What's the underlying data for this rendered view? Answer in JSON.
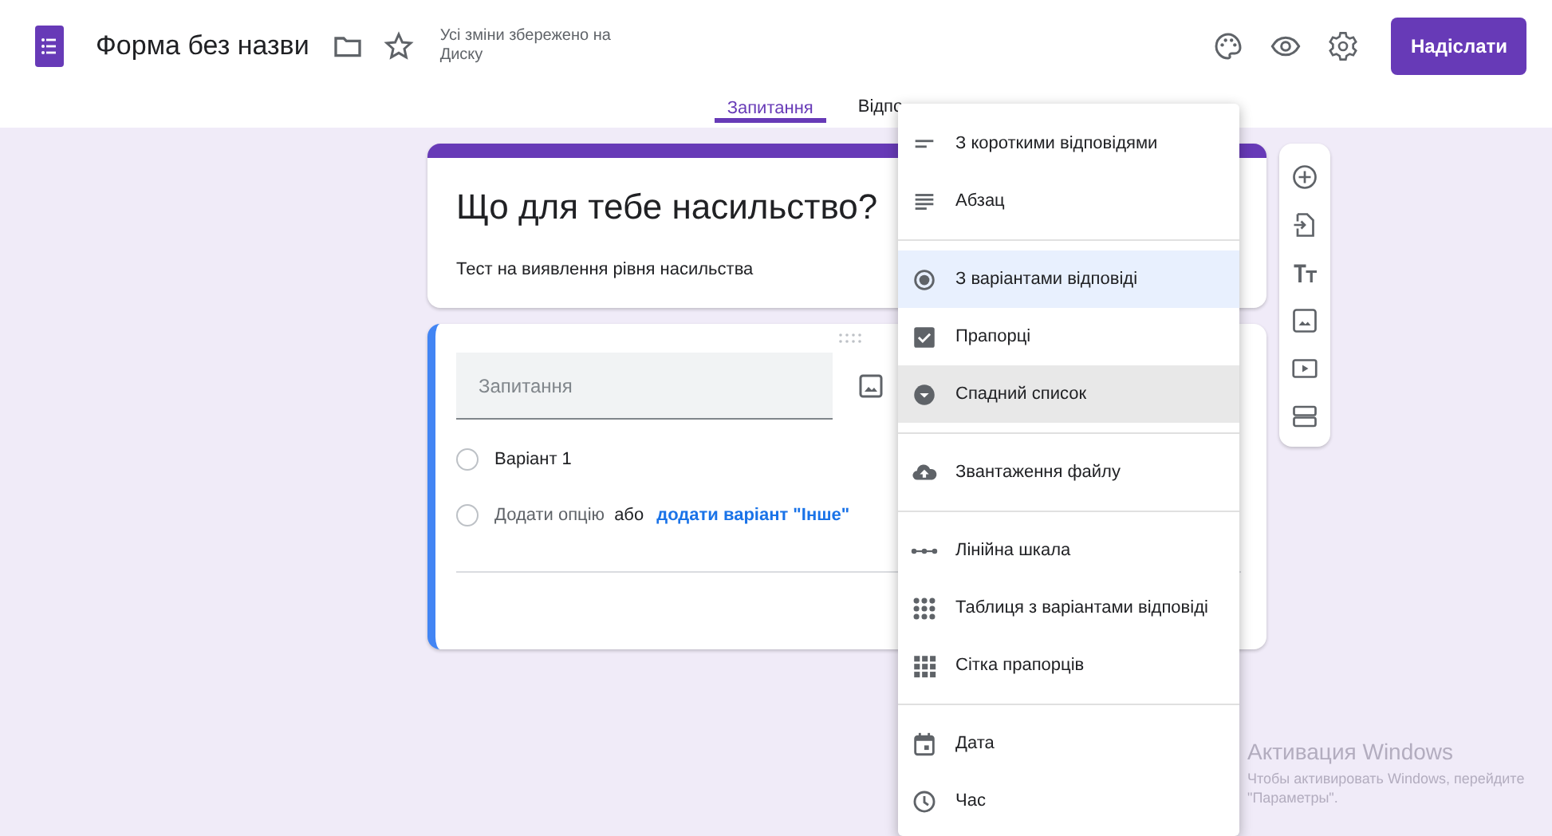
{
  "header": {
    "title": "Форма без назви",
    "save_status": "Усі зміни збережено на Диску",
    "send_button": "Надіслати"
  },
  "tabs": [
    {
      "label": "Запитання",
      "selected": true
    },
    {
      "label": "Відпо",
      "selected": false
    }
  ],
  "title_card": {
    "title": "Що для тебе насильство?",
    "description": "Тест на виявлення рівня насильства"
  },
  "question_card": {
    "placeholder": "Запитання",
    "options": [
      {
        "kind": "option",
        "label": "Варіант 1"
      },
      {
        "kind": "add",
        "label": "Додати опцію",
        "separator": "або",
        "link": "додати варіант \"Інше\""
      }
    ]
  },
  "type_menu": {
    "groups": [
      [
        {
          "kind": "short",
          "label": "З короткими відповідями",
          "selected": false,
          "hovered": false
        },
        {
          "kind": "paragraph",
          "label": "Абзац",
          "selected": false,
          "hovered": false
        }
      ],
      [
        {
          "kind": "radio",
          "label": "З варіантами відповіді",
          "selected": true,
          "hovered": false
        },
        {
          "kind": "checkbox",
          "label": "Прапорці",
          "selected": false,
          "hovered": false
        },
        {
          "kind": "dropdown",
          "label": "Спадний список",
          "selected": false,
          "hovered": true
        }
      ],
      [
        {
          "kind": "upload",
          "label": "Звантаження файлу",
          "selected": false,
          "hovered": false
        }
      ],
      [
        {
          "kind": "scale",
          "label": "Лінійна шкала",
          "selected": false,
          "hovered": false
        },
        {
          "kind": "grid",
          "label": "Таблиця з варіантами відповіді",
          "selected": false,
          "hovered": false
        },
        {
          "kind": "checkgrid",
          "label": "Сітка прапорців",
          "selected": false,
          "hovered": false
        }
      ],
      [
        {
          "kind": "date",
          "label": "Дата",
          "selected": false,
          "hovered": false
        },
        {
          "kind": "time",
          "label": "Час",
          "selected": false,
          "hovered": false
        }
      ]
    ]
  },
  "activation_notice": {
    "title": "Активация Windows",
    "text": "Чтобы активировать Windows, перейдите",
    "text_2": "\"Параметры\"."
  }
}
